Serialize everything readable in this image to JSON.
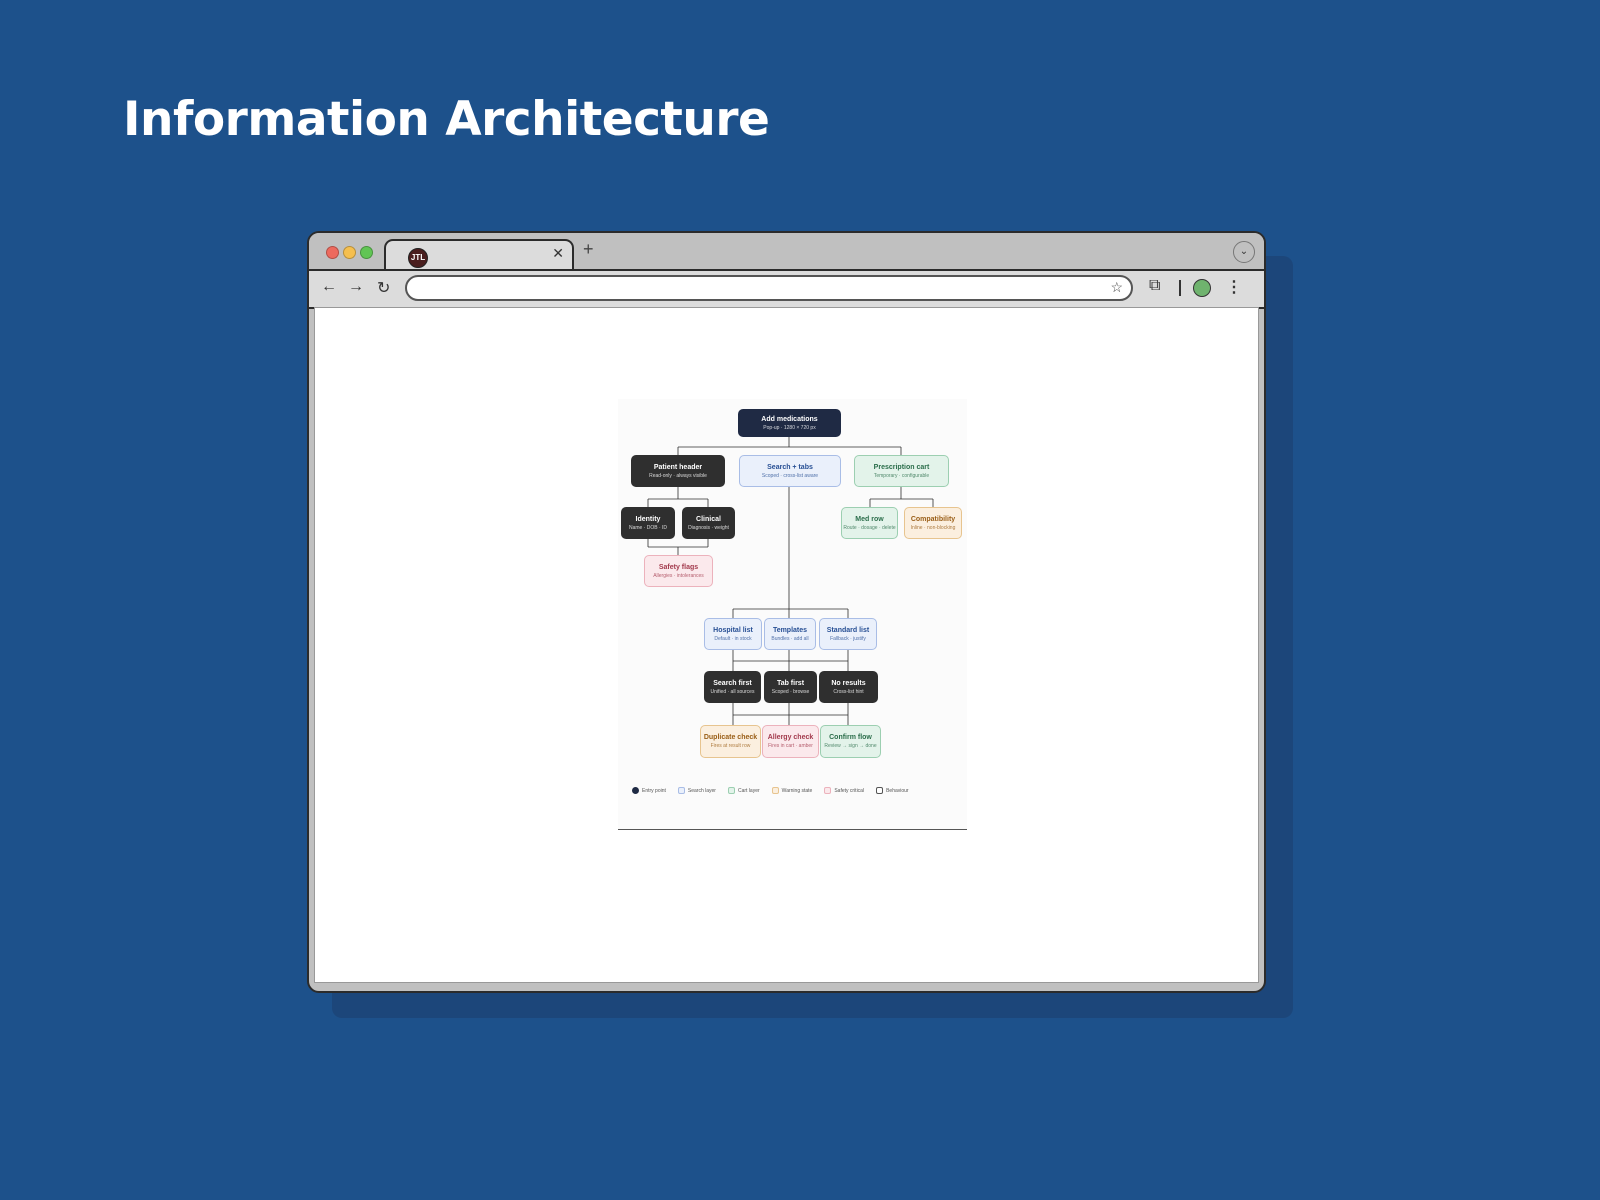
{
  "slide": {
    "title": "Information Architecture"
  },
  "browser": {
    "tab": {
      "favicon_text": "JTL",
      "close_glyph": "✕"
    },
    "new_tab_glyph": "+",
    "tab_menu_glyph": "⌄",
    "toolbar": {
      "back_glyph": "←",
      "forward_glyph": "→",
      "reload_glyph": "↻",
      "address_value": "",
      "star_glyph": "☆",
      "extensions_glyph": "⧉",
      "menu_glyph": "⋮"
    }
  },
  "diagram": {
    "nodes": [
      {
        "key": "root",
        "title": "Add medications",
        "sub": "Pop-up · 1280 × 720 px",
        "style": "navy"
      },
      {
        "key": "patient",
        "title": "Patient header",
        "sub": "Read-only · always visible",
        "style": "dark"
      },
      {
        "key": "search",
        "title": "Search + tabs",
        "sub": "Scoped · cross-list aware",
        "style": "blue"
      },
      {
        "key": "cart",
        "title": "Prescription cart",
        "sub": "Temporary · configurable",
        "style": "green"
      },
      {
        "key": "identity",
        "title": "Identity",
        "sub": "Name · DOB · ID",
        "style": "dark"
      },
      {
        "key": "clinical",
        "title": "Clinical",
        "sub": "Diagnosis · weight",
        "style": "dark"
      },
      {
        "key": "medrow",
        "title": "Med row",
        "sub": "Route · dosage · delete",
        "style": "green"
      },
      {
        "key": "compat",
        "title": "Compatibility",
        "sub": "Inline · non-blocking",
        "style": "amber"
      },
      {
        "key": "safety",
        "title": "Safety flags",
        "sub": "Allergies · intolerances",
        "style": "pink"
      },
      {
        "key": "hospital",
        "title": "Hospital list",
        "sub": "Default · in stock",
        "style": "blue"
      },
      {
        "key": "templates",
        "title": "Templates",
        "sub": "Bundles · add all",
        "style": "blue"
      },
      {
        "key": "standard",
        "title": "Standard list",
        "sub": "Fallback · justify",
        "style": "blue"
      },
      {
        "key": "searchfirst",
        "title": "Search first",
        "sub": "Unified · all sources",
        "style": "dark"
      },
      {
        "key": "tabfirst",
        "title": "Tab first",
        "sub": "Scoped · browse",
        "style": "dark"
      },
      {
        "key": "noresults",
        "title": "No results",
        "sub": "Cross-list hint",
        "style": "dark"
      },
      {
        "key": "dup",
        "title": "Duplicate check",
        "sub": "Fires at result row",
        "style": "amber"
      },
      {
        "key": "allergy",
        "title": "Allergy check",
        "sub": "Fires in cart · amber",
        "style": "pink"
      },
      {
        "key": "confirm",
        "title": "Confirm flow",
        "sub": "Review → sign → done",
        "style": "green"
      }
    ],
    "legend": [
      {
        "label": "Entry point",
        "style": "navy"
      },
      {
        "label": "Search layer",
        "style": "blue"
      },
      {
        "label": "Cart layer",
        "style": "green"
      },
      {
        "label": "Warning state",
        "style": "amber"
      },
      {
        "label": "Safety critical",
        "style": "pink"
      },
      {
        "label": "Behaviour",
        "style": "outline"
      }
    ]
  }
}
